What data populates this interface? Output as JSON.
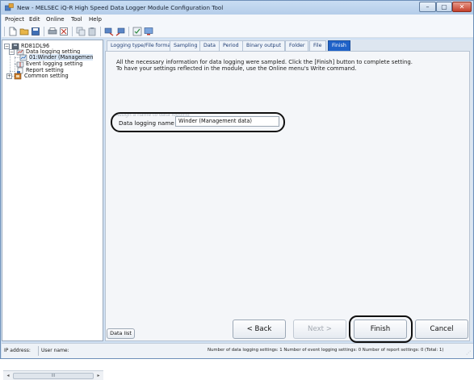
{
  "window": {
    "title": "New - MELSEC iQ-R High Speed Data Logger Module Configuration Tool",
    "controls": {
      "minimize": "–",
      "maximize": "▢",
      "close": "✕"
    }
  },
  "menu": [
    {
      "label": "Project"
    },
    {
      "label": "Edit"
    },
    {
      "label": "Online"
    },
    {
      "label": "Tool"
    },
    {
      "label": "Help"
    }
  ],
  "toolbar": {
    "icons": [
      "new-icon",
      "open-icon",
      "save-icon",
      "print-icon",
      "cut-icon",
      "copy-icon",
      "paste-icon",
      "read-icon",
      "write-icon",
      "verify-icon",
      "monitor-icon"
    ]
  },
  "tree": {
    "root": "RD81DL96",
    "data_logging": "Data logging setting",
    "winder": "01:Winder (Managemen",
    "event_logging": "Event logging setting",
    "report": "Report setting",
    "common": "Common setting",
    "scroll_mark": "III"
  },
  "tabs": [
    {
      "label": "Logging type/File format",
      "active": false
    },
    {
      "label": "Sampling",
      "active": false
    },
    {
      "label": "Data",
      "active": false
    },
    {
      "label": "Period",
      "active": false
    },
    {
      "label": "Binary output",
      "active": false
    },
    {
      "label": "Folder",
      "active": false
    },
    {
      "label": "File",
      "active": false
    },
    {
      "label": "Finish",
      "active": true
    }
  ],
  "content": {
    "message_line1": "All the necessary information for data logging were sampled. Click the [Finish] button to complete setting.",
    "message_line2": "To have your settings reflected in the module, use the Online menu's Write command.",
    "faint_hint": "Assign a name to data logging",
    "name_label": "Data logging name",
    "name_value": "Winder (Management data)"
  },
  "buttons": {
    "data_list": "Data list",
    "back": "< Back",
    "next": "Next >",
    "finish": "Finish",
    "cancel": "Cancel"
  },
  "status": {
    "ip": "IP address:",
    "user": "User name:",
    "counts": "Number of data logging settings: 1   Number of event logging settings: 0   Number of report settings: 0   (Total: 1)"
  }
}
